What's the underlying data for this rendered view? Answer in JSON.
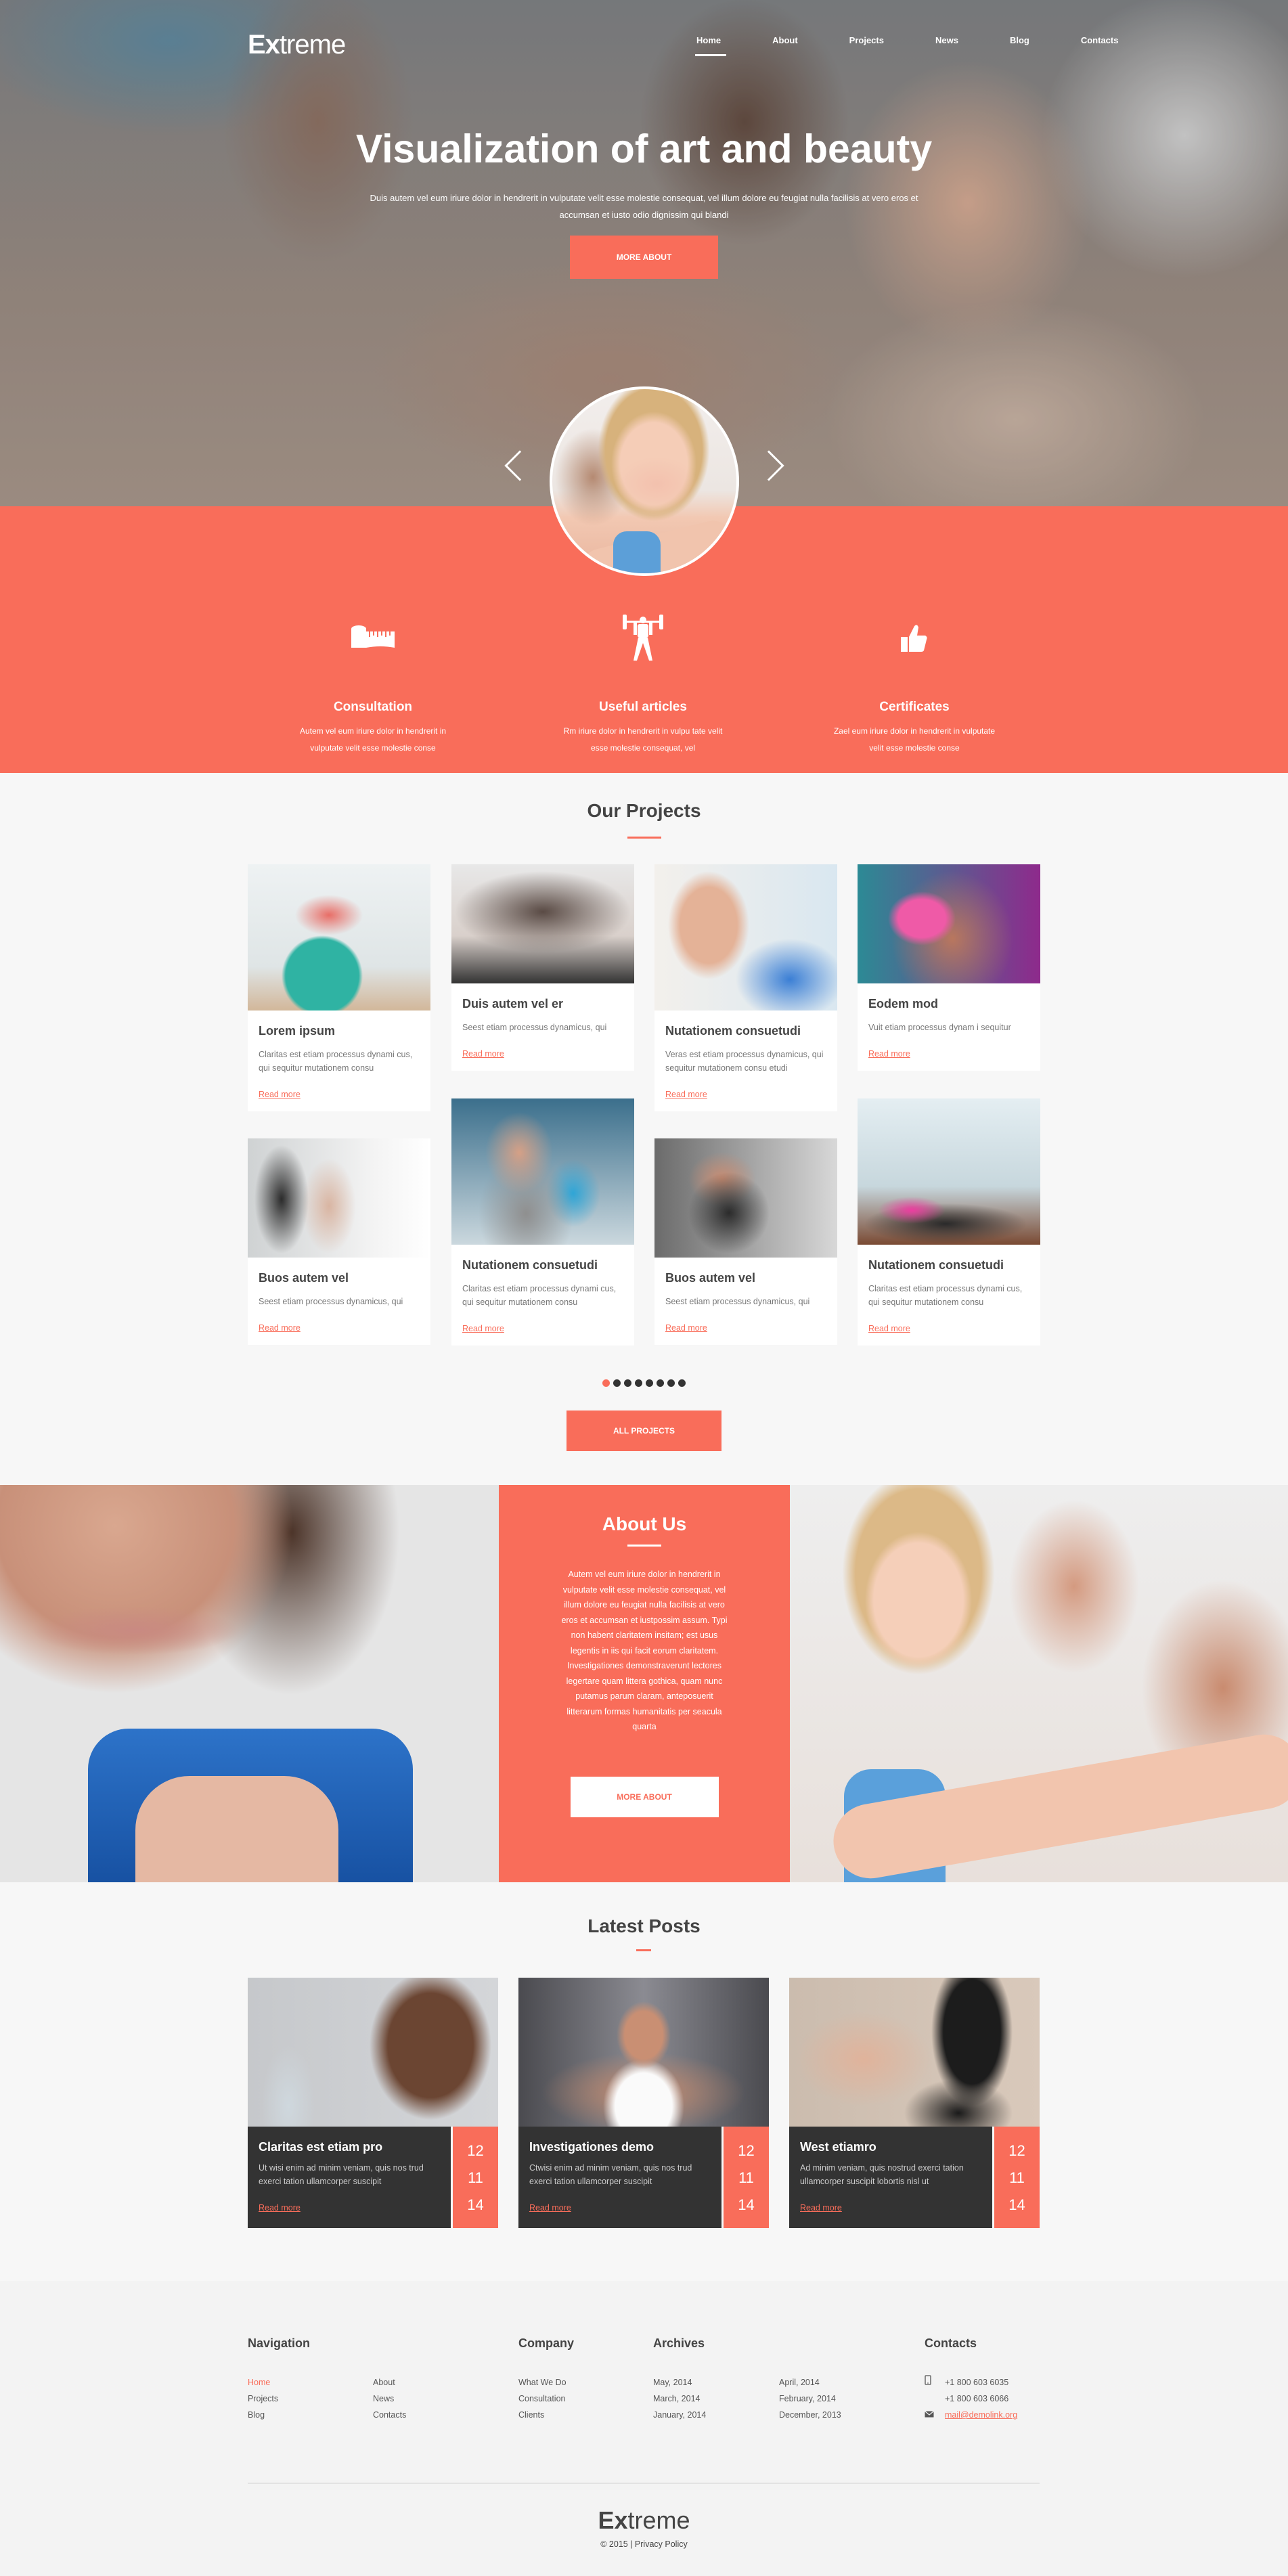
{
  "brand": {
    "bold": "Ex",
    "light": "treme"
  },
  "nav": [
    {
      "label": "Home",
      "active": true
    },
    {
      "label": "About"
    },
    {
      "label": "Projects"
    },
    {
      "label": "News"
    },
    {
      "label": "Blog"
    },
    {
      "label": "Contacts"
    }
  ],
  "hero": {
    "title": "Visualization of art and beauty",
    "text": "Duis autem vel eum iriure dolor in hendrerit in vulputate velit esse molestie consequat, vel illum dolore eu feugiat nulla facilisis at vero eros et accumsan et iusto odio dignissim qui blandi",
    "button": "MORE ABOUT",
    "prev_icon": "chevron-left-icon",
    "next_icon": "chevron-right-icon"
  },
  "features": [
    {
      "icon": "measuring-tape-icon",
      "title": "Consultation",
      "text": "Autem vel eum iriure dolor in hendrerit in vulputate velit esse molestie conse"
    },
    {
      "icon": "weightlifter-icon",
      "title": "Useful articles",
      "text": "Rm iriure dolor in hendrerit in vulpu tate velit esse molestie consequat, vel"
    },
    {
      "icon": "thumbs-up-icon",
      "title": "Certificates",
      "text": "Zael eum iriure dolor in hendrerit in vulputate velit esse molestie conse"
    }
  ],
  "projects": {
    "title": "Our Projects",
    "items": [
      {
        "title": "Lorem ipsum",
        "text": "Claritas est etiam processus dynami cus, qui sequitur mutationem consu",
        "link": "Read more"
      },
      {
        "title": "Duis autem vel er",
        "text": "Seest etiam processus dynamicus, qui",
        "link": "Read more"
      },
      {
        "title": "Nutationem consuetudi",
        "text": "Veras est etiam processus dynamicus, qui sequitur mutationem consu etudi",
        "link": "Read more"
      },
      {
        "title": "Eodem mod",
        "text": "Vuit etiam processus dynam i sequitur",
        "link": "Read more"
      },
      {
        "title": "Buos autem vel",
        "text": "Seest etiam processus dynamicus, qui",
        "link": "Read more"
      },
      {
        "title": "Nutationem consuetudi",
        "text": "Claritas est etiam processus dynami cus, qui sequitur mutationem consu",
        "link": "Read more"
      },
      {
        "title": "Buos autem vel",
        "text": "Seest etiam processus dynamicus, qui",
        "link": "Read more"
      },
      {
        "title": "Nutationem consuetudi",
        "text": "Claritas est etiam processus dynami cus, qui sequitur mutationem consu",
        "link": "Read more"
      }
    ],
    "pagination": {
      "pages": 8,
      "current": 1
    },
    "button": "ALL PROJECTS"
  },
  "about": {
    "title": "About Us",
    "text": "Autem vel eum iriure dolor in hendrerit in vulputate velit esse molestie consequat, vel illum dolore eu feugiat nulla facilisis at vero eros et accumsan et iustpossim assum. Typi non habent claritatem insitam; est usus legentis in iis qui facit eorum claritatem. Investigationes demonstraverunt lectores legertare quam littera gothica, quam nunc putamus parum claram, anteposuerit litterarum formas humanitatis per seacula quarta",
    "button": "MORE ABOUT"
  },
  "posts": {
    "title": "Latest Posts",
    "items": [
      {
        "title": "Claritas est etiam pro",
        "text": "Ut wisi enim ad minim veniam, quis nos trud exerci tation ullamcorper suscipit",
        "link": "Read more",
        "date": [
          "12",
          "11",
          "14"
        ]
      },
      {
        "title": "Investigationes demo",
        "text": "Ctwisi enim ad minim veniam, quis nos trud exerci tation ullamcorper suscipit",
        "link": "Read more",
        "date": [
          "12",
          "11",
          "14"
        ]
      },
      {
        "title": "West etiamro",
        "text": "Ad minim veniam, quis nostrud exerci tation ullamcorper suscipit lobortis nisl ut",
        "link": "Read more",
        "date": [
          "12",
          "11",
          "14"
        ]
      }
    ]
  },
  "footer": {
    "navigation": {
      "title": "Navigation",
      "col1": [
        "Home",
        "Projects",
        "Blog"
      ],
      "col2": [
        "About",
        "News",
        "Contacts"
      ]
    },
    "company": {
      "title": "Company",
      "items": [
        "What We Do",
        "Consultation",
        "Clients"
      ]
    },
    "archives": {
      "title": "Archives",
      "col1": [
        "May, 2014",
        "March, 2014",
        "January, 2014"
      ],
      "col2": [
        "April, 2014",
        "February, 2014",
        "December, 2013"
      ]
    },
    "contacts": {
      "title": "Contacts",
      "phone1": "+1 800 603 6035",
      "phone2": "+1 800 603 6066",
      "email": "mail@demolink.org",
      "phone_icon": "phone-icon",
      "mail_icon": "envelope-icon"
    },
    "copyright": "© 2015 | Privacy Policy"
  },
  "colors": {
    "accent": "#f96d5a",
    "dark": "#333333",
    "text": "#444444",
    "bg": "#f7f7f7",
    "footer_bg": "#f3f3f3"
  }
}
